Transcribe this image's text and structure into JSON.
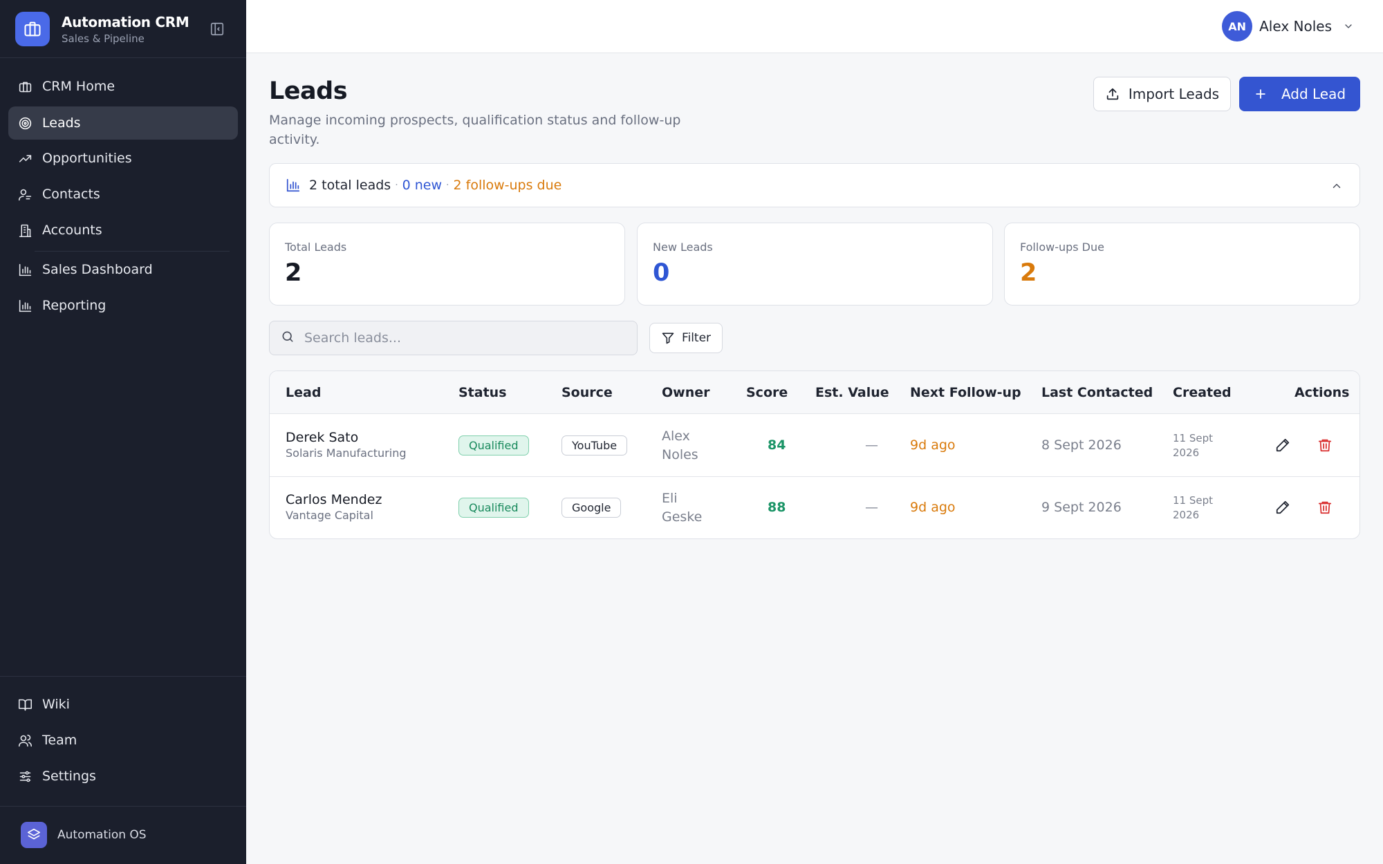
{
  "app": {
    "name": "Automation CRM",
    "subtitle": "Sales & Pipeline",
    "brand_color": "#4a6ae8"
  },
  "sidebar": {
    "items": [
      {
        "label": "CRM Home",
        "icon": "building-icon",
        "active": false
      },
      {
        "label": "Leads",
        "icon": "target-icon",
        "active": true
      },
      {
        "label": "Opportunities",
        "icon": "trending-up-icon",
        "active": false
      },
      {
        "label": "Contacts",
        "icon": "contact-icon",
        "active": false
      },
      {
        "label": "Accounts",
        "icon": "building-2-icon",
        "active": false
      },
      {
        "label": "Sales Dashboard",
        "icon": "bar-chart-icon",
        "active": false
      },
      {
        "label": "Reporting",
        "icon": "bar-chart-icon",
        "active": false
      }
    ],
    "bottom_items": [
      {
        "label": "Wiki",
        "icon": "book-icon"
      },
      {
        "label": "Team",
        "icon": "users-icon"
      },
      {
        "label": "Settings",
        "icon": "sliders-icon"
      }
    ],
    "footer": {
      "label": "Automation OS",
      "icon": "layers-icon"
    }
  },
  "topbar": {
    "user_initials": "AN",
    "user_name": "Alex Noles"
  },
  "page": {
    "title": "Leads",
    "subtitle": "Manage incoming prospects, qualification status and follow-up activity.",
    "import_label": "Import Leads",
    "add_label": "Add Lead"
  },
  "summary": {
    "total_text": "2 total leads",
    "sep": "·",
    "new_text": "0 new",
    "due_text": "2 follow-ups due"
  },
  "stats": [
    {
      "label": "Total Leads",
      "value": "2"
    },
    {
      "label": "New Leads",
      "value": "0"
    },
    {
      "label": "Follow-ups Due",
      "value": "2"
    }
  ],
  "search": {
    "placeholder": "Search leads..."
  },
  "filter_label": "Filter",
  "table": {
    "columns": [
      "Lead",
      "Status",
      "Source",
      "Owner",
      "Score",
      "Est. Value",
      "Next Follow-up",
      "Last Contacted",
      "Created",
      "Actions"
    ],
    "rows": [
      {
        "name": "Derek Sato",
        "company": "Solaris Manufacturing",
        "status": "Qualified",
        "source": "YouTube",
        "owner_first": "Alex",
        "owner_last": "Noles",
        "score": "84",
        "est_value": "—",
        "next_followup": "9d ago",
        "last_contacted": "8 Sept 2026",
        "created_day": "11 Sept",
        "created_year": "2026"
      },
      {
        "name": "Carlos Mendez",
        "company": "Vantage Capital",
        "status": "Qualified",
        "source": "Google",
        "owner_first": "Eli",
        "owner_last": "Geske",
        "score": "88",
        "est_value": "—",
        "next_followup": "9d ago",
        "last_contacted": "9 Sept 2026",
        "created_day": "11 Sept",
        "created_year": "2026"
      }
    ]
  },
  "colors": {
    "primary": "#3455d1",
    "warning": "#d97a0b",
    "success": "#1a9466",
    "danger": "#d92d2d",
    "sidebar_bg": "#1b1f2c"
  }
}
